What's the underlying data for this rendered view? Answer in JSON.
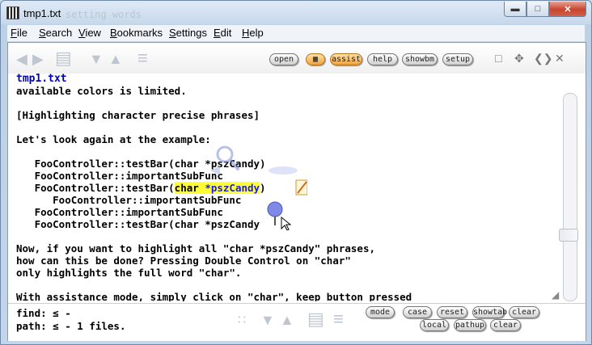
{
  "window": {
    "title": "tmp1.txt",
    "ghost_title": "setting words",
    "minimize_icon": "minimize-icon",
    "maximize_icon": "maximize-icon",
    "close_icon": "close-icon"
  },
  "menubar": {
    "items": [
      {
        "first": "F",
        "rest": "ile"
      },
      {
        "first": "S",
        "rest": "earch"
      },
      {
        "first": "V",
        "rest": "iew"
      },
      {
        "first": "B",
        "rest": "ookmarks"
      },
      {
        "first": "S",
        "rest": "ettings"
      },
      {
        "first": "E",
        "rest": "dit"
      },
      {
        "first": "H",
        "rest": "elp"
      }
    ]
  },
  "toolbar": {
    "open_label": "open",
    "assist_label": "assist",
    "help_label": "help",
    "showbm_label": "showbm",
    "setup_label": "setup"
  },
  "editor": {
    "filename": "tmp1.txt",
    "lines": [
      "available colors is limited.",
      "",
      "[Highlighting character precise phrases]",
      "",
      "Let's look again at the example:",
      "",
      "   FooController::testBar(char *pszCandy)",
      "   FooController::importantSubFunc",
      "   FooController::testBar(",
      "      FooController::importantSubFunc",
      "   FooController::importantSubFunc",
      "   FooController::testBar(char *pszCandy",
      "",
      "Now, if you want to highlight all \"char *pszCandy\" phrases,",
      "how can this be done? Pressing Double Control on \"char\"",
      "only highlights the full word \"char\".",
      "",
      "With assistance mode, simply click on \"char\", keep button pressed"
    ],
    "highlight_plain": "char ",
    "highlight_blue": "*pszCandy",
    "highlight_tail": ")"
  },
  "bottom": {
    "find_label": "find:",
    "find_value": "≤ -",
    "path_label": "path:",
    "path_value": "≤ - 1 files.",
    "mode_label": "mode",
    "case_label": "case",
    "reset_label": "reset",
    "showtab_label": "showtab",
    "clear_label": "clear",
    "local_label": "local",
    "pathup_label": "pathup",
    "clear2_label": "clear"
  }
}
